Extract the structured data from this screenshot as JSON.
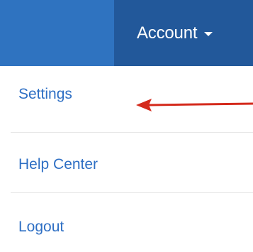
{
  "navbar": {
    "account_label": "Account",
    "caret_icon": "caret-down-icon",
    "bar_color": "#2f73c0",
    "active_color": "#22589a"
  },
  "menu": {
    "items": [
      {
        "label": "Settings"
      },
      {
        "label": "Help Center"
      },
      {
        "label": "Logout"
      }
    ],
    "link_color": "#2e6fc4"
  },
  "annotation": {
    "type": "arrow",
    "color": "#d42a1c",
    "points_to": "Settings"
  }
}
